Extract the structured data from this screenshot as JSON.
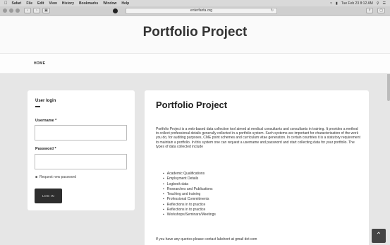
{
  "menubar": {
    "items": [
      "Safari",
      "File",
      "Edit",
      "View",
      "History",
      "Bookmarks",
      "Window",
      "Help"
    ],
    "status": "Tue Feb 23 8:12 AM"
  },
  "toolbar": {
    "url": "enterfanta.org"
  },
  "site": {
    "title": "Portfolio Project"
  },
  "nav": {
    "home": "HOME"
  },
  "login": {
    "title": "User login",
    "username_label": "Username *",
    "username_value": "",
    "password_label": "Password *",
    "password_value": "",
    "request_link": "Request new password",
    "button": "LOG IN"
  },
  "content": {
    "heading": "Portfolio Project",
    "paragraph": "Portfolio Project is a web-based data collection tool aimed at medical consultants and consultants in training. It provides a method to collect professional details generally collected in a portfolio system. Such systems are important for characterisation of the work you do, for auditing purposes, CME point schemes and curriculum vitae generation. In certain countries it is a statutory requirement to maintain a portfolio. In this system one can request a username and password and start collecting data for your portfolio. The types of data collected include",
    "items": [
      "Academic Qualifications",
      "Employment Details",
      "Logbook data",
      "Researches and Publications",
      "Teaching and training",
      "Professional Commitments",
      "Reflections in to practice",
      "Reflections in to practice",
      "Workshops/Seminars/Meetings"
    ],
    "contact": "If you have any queries please contact lakshent at gmail dot com"
  }
}
